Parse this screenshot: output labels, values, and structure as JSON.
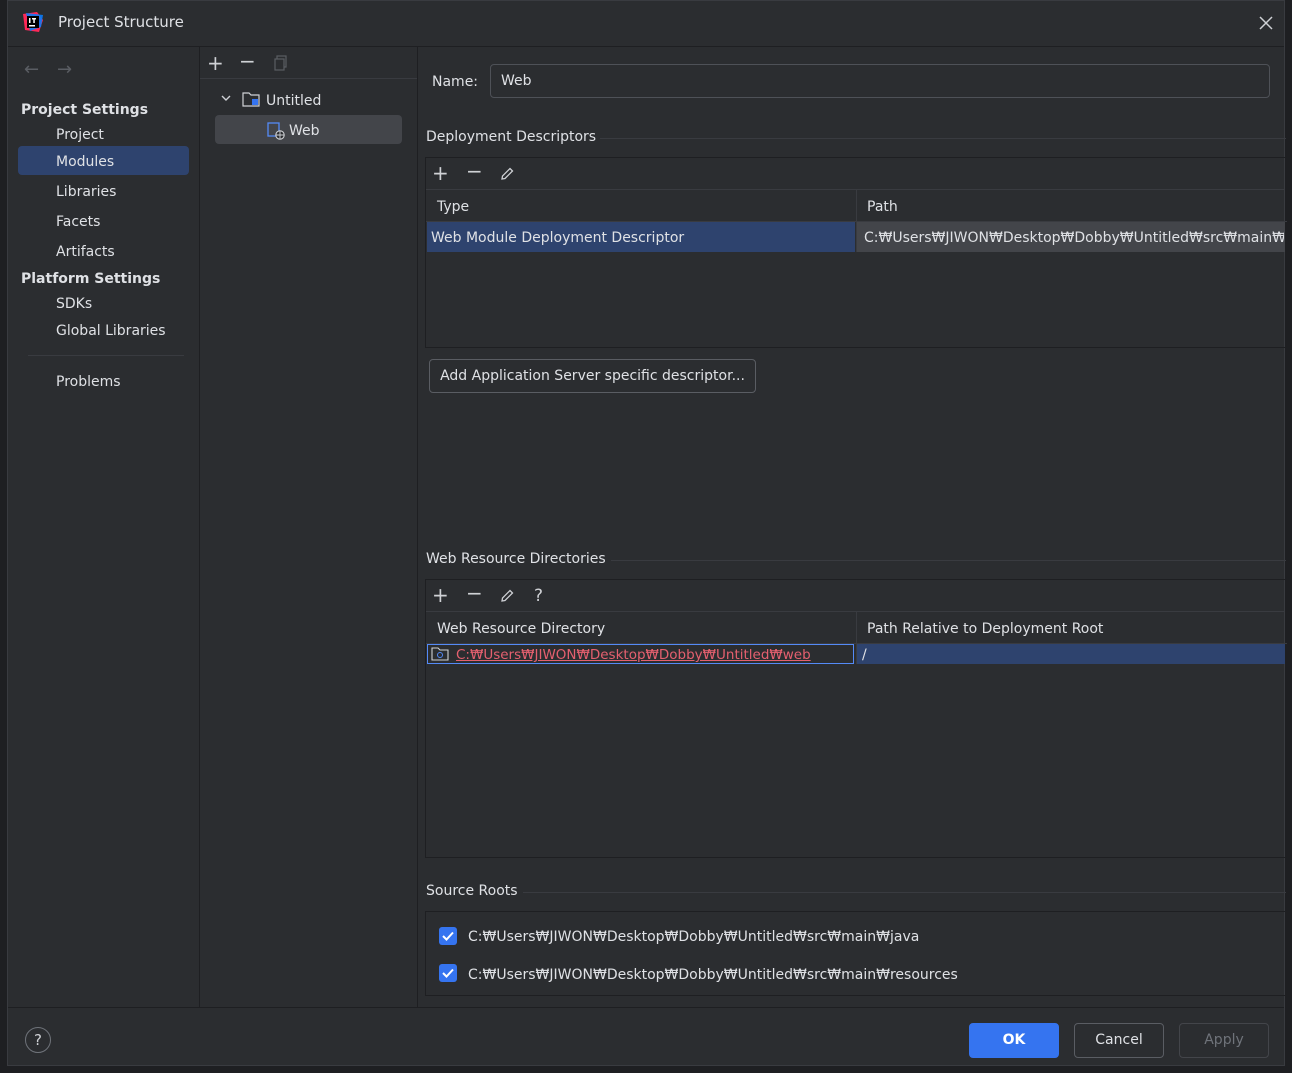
{
  "window": {
    "title": "Project Structure"
  },
  "sidebar": {
    "project_settings_header": "Project Settings",
    "project_settings_items": [
      {
        "label": "Project"
      },
      {
        "label": "Modules"
      },
      {
        "label": "Libraries"
      },
      {
        "label": "Facets"
      },
      {
        "label": "Artifacts"
      }
    ],
    "platform_settings_header": "Platform Settings",
    "platform_settings_items": [
      {
        "label": "SDKs"
      },
      {
        "label": "Global Libraries"
      }
    ],
    "problems_label": "Problems",
    "selected": "Modules"
  },
  "tree": {
    "root_label": "Untitled",
    "child_label": "Web"
  },
  "details": {
    "name_label": "Name:",
    "name_value": "Web",
    "deployment_descriptors": {
      "title": "Deployment Descriptors",
      "columns": [
        "Type",
        "Path"
      ],
      "rows": [
        {
          "type": "Web Module Deployment Descriptor",
          "path": "C:₩Users₩JIWON₩Desktop₩Dobby₩Untitled₩src₩main₩webapp₩WEB-INF₩web.xml"
        }
      ],
      "add_server_button": "Add Application Server specific descriptor..."
    },
    "web_resource_directories": {
      "title": "Web Resource Directories",
      "columns": [
        "Web Resource Directory",
        "Path Relative to Deployment Root"
      ],
      "rows": [
        {
          "directory": "C:₩Users₩JIWON₩Desktop₩Dobby₩Untitled₩web",
          "relative": "/"
        }
      ]
    },
    "source_roots": {
      "title": "Source Roots",
      "items": [
        {
          "path": "C:₩Users₩JIWON₩Desktop₩Dobby₩Untitled₩src₩main₩java",
          "checked": true
        },
        {
          "path": "C:₩Users₩JIWON₩Desktop₩Dobby₩Untitled₩src₩main₩resources",
          "checked": true
        }
      ]
    }
  },
  "footer": {
    "ok": "OK",
    "cancel": "Cancel",
    "apply": "Apply"
  },
  "colors": {
    "background": "#2b2d30",
    "selection": "#2e436e",
    "accent": "#3574f0",
    "error_path": "#e5606f"
  }
}
